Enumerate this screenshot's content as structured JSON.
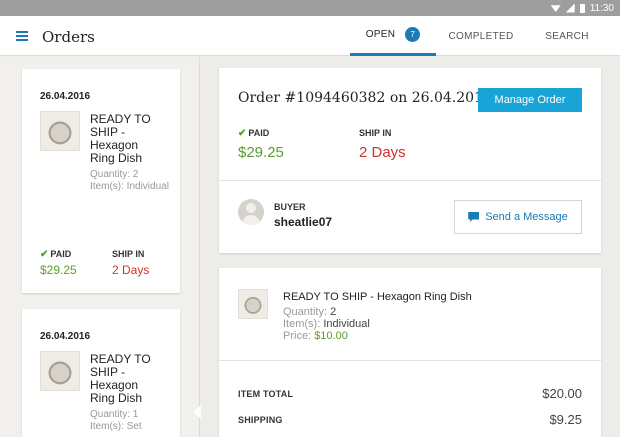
{
  "status_bar": {
    "time": "11:30"
  },
  "app_bar": {
    "title": "Orders",
    "tabs": [
      {
        "label": "OPEN",
        "badge": "7",
        "active": true
      },
      {
        "label": "COMPLETED"
      },
      {
        "label": "SEARCH"
      }
    ]
  },
  "sidebar": {
    "orders": [
      {
        "date": "26.04.2016",
        "title": "READY TO SHIP - Hexagon Ring Dish",
        "meta": [
          "Quantity: 2",
          "Item(s): Individual"
        ],
        "paid_label": "PAID",
        "amount": "$29.25",
        "ship_label": "SHIP IN",
        "ship_value": "2 Days"
      },
      {
        "date": "26.04.2016",
        "title": "READY TO SHIP - Hexagon Ring Dish",
        "meta": [
          "Quantity: 1",
          "Item(s): Set"
        ]
      }
    ]
  },
  "order": {
    "title": "Order #1094460382 on 26.04.2016",
    "manage_label": "Manage Order",
    "paid_label": "PAID",
    "amount": "$29.25",
    "ship_label": "SHIP IN",
    "ship_value": "2 Days",
    "buyer_label": "BUYER",
    "buyer_name": "sheatlie07",
    "message_label": "Send a Message"
  },
  "item": {
    "title": "READY TO SHIP - Hexagon Ring Dish",
    "quantity_label": "Quantity:",
    "quantity_value": "2",
    "items_label": "Item(s):",
    "items_value": "Individual",
    "price_label": "Price:",
    "price_value": "$10.00"
  },
  "totals": [
    {
      "label": "ITEM TOTAL",
      "value": "$20.00"
    },
    {
      "label": "SHIPPING",
      "value": "$9.25"
    }
  ],
  "colors": {
    "accent": "#1a7bb5",
    "button": "#1aa3d6",
    "paid_green": "#5a9e2a",
    "ship_red": "#d0322a"
  }
}
